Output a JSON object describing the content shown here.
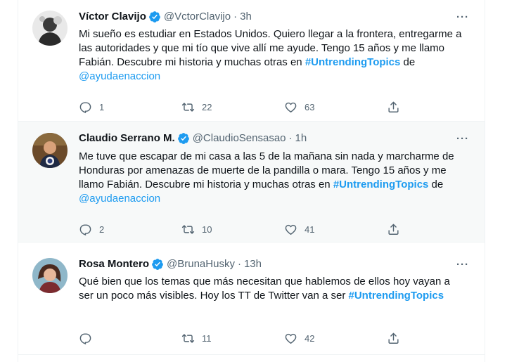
{
  "colors": {
    "accent": "#1d9bf0",
    "text": "#0f1419",
    "secondary": "#536471",
    "highlight_bg": "#f7f9f9"
  },
  "tweets": [
    {
      "name": "Víctor Clavijo",
      "handle": "@VctorClavijo",
      "separator": "·",
      "time": "3h",
      "more": "···",
      "verified": true,
      "text": "Mi sueño es estudiar en Estados Unidos. Quiero llegar a la frontera, entregarme a las autoridades y que mi tío que vive allí me ayude. Tengo 15 años y me llamo Fabián. Descubre mi historia y muchas otras en ",
      "hashtag": "#UntrendingTopics",
      "connector": " de ",
      "mention": "@ayudaenaccion",
      "replies": "1",
      "retweets": "22",
      "likes": "63"
    },
    {
      "name": "Claudio Serrano M.",
      "handle": "@ClaudioSensasao",
      "separator": "·",
      "time": "1h",
      "more": "···",
      "verified": true,
      "text": "Me tuve que escapar de mi casa a las 5 de la mañana sin nada y marcharme de Honduras por amenazas de muerte de la pandilla o mara. Tengo 15 años y me llamo Fabián. Descubre mi historia y muchas otras en ",
      "hashtag": "#UntrendingTopics",
      "connector": " de ",
      "mention": "@ayudaenaccion",
      "replies": "2",
      "retweets": "10",
      "likes": "41"
    },
    {
      "name": "Rosa Montero",
      "handle": "@BrunaHusky",
      "separator": "·",
      "time": "13h",
      "more": "···",
      "verified": true,
      "text": "Qué bien que los temas que más necesitan que hablemos de ellos hoy vayan a ser un poco más visibles. Hoy los TT de Twitter van a ser ",
      "hashtag": "#UntrendingTopics",
      "replies": "",
      "retweets": "11",
      "likes": "42"
    }
  ]
}
